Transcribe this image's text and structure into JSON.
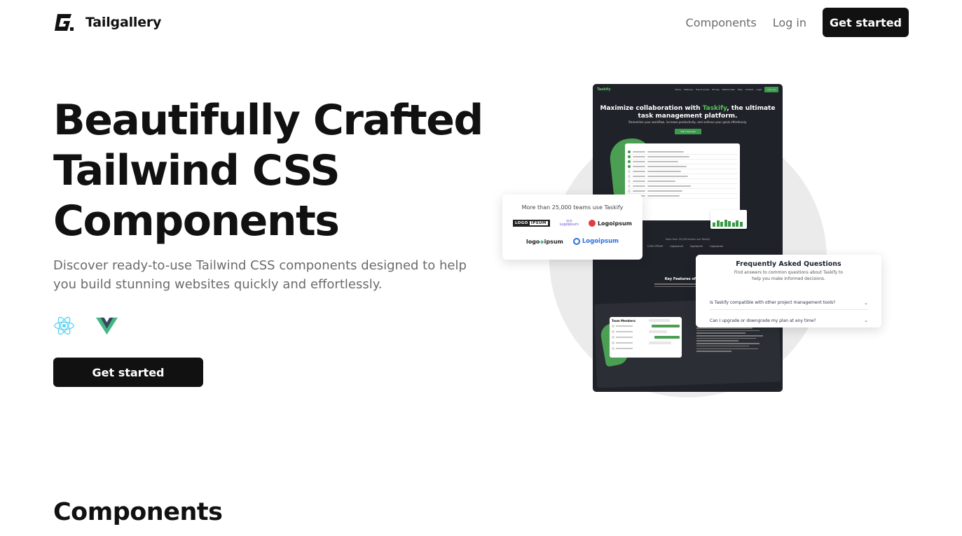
{
  "header": {
    "logo_text": "Tailgallery",
    "nav": {
      "components": "Components",
      "login": "Log in",
      "cta": "Get started"
    }
  },
  "hero": {
    "title_line1": "Beautifully Crafted",
    "title_line2": "Tailwind CSS",
    "title_line3": "Components",
    "subtitle": "Discover ready-to-use Tailwind CSS components designed to help you build stunning websites quickly and effortlessly.",
    "frameworks": [
      "react-icon",
      "vue-icon"
    ],
    "cta": "Get started"
  },
  "preview": {
    "trust_card": {
      "text": "More than 25,000 teams use Taskify",
      "logos": [
        "LOGO IPSUM",
        "Logoipsum",
        "Logoipsum",
        "logoipsum",
        "Logoipsum"
      ]
    },
    "faq_card": {
      "title": "Frequently Asked Questions",
      "subtitle": "Find answers to common questions about Taskify to help you make informed decisions.",
      "questions": [
        "Is Taskify compatible with other project management tools?",
        "Can I upgrade or downgrade my plan at any time?"
      ]
    },
    "mockup": {
      "brand": "Taskify",
      "nav": [
        "Home",
        "Features",
        "How it works",
        "Pricing",
        "Testimonials",
        "Faqs",
        "Contact",
        "Login"
      ],
      "nav_cta": "Sign Up",
      "heading_pre": "Maximize collaboration with ",
      "heading_accent": "Taskify",
      "heading_post": ", the ultimate task management platform.",
      "subtext": "Streamline your workflow, increase productivity, and achieve your goals effortlessly.",
      "button": "Start free trial",
      "trust": "More than 25,000 teams use Taskify",
      "features_heading": "Key Features of Taskify",
      "team_title": "Team Members"
    }
  },
  "section": {
    "title": "Components"
  },
  "colors": {
    "primary": "#111111",
    "muted": "#6b6b6b",
    "accent_green": "#4a9f53",
    "mock_bg": "#1f2229"
  }
}
